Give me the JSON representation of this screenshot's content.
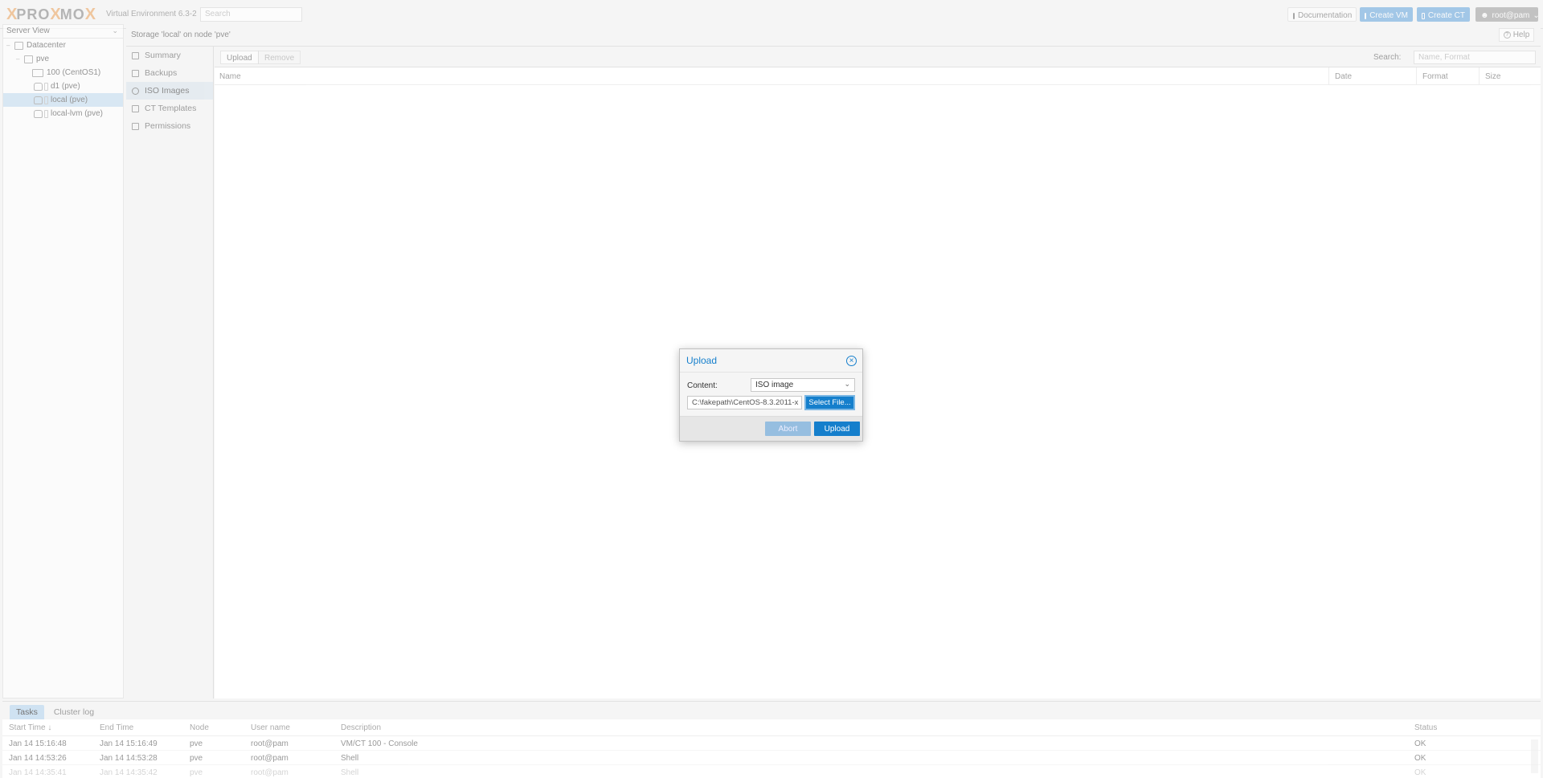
{
  "topbar": {
    "logo_text": "PRO",
    "logo_text2": "MO",
    "version": "Virtual Environment 6.3-2",
    "search_placeholder": "Search",
    "documentation_label": "Documentation",
    "create_vm_label": "Create VM",
    "create_ct_label": "Create CT",
    "user_label": "root@pam"
  },
  "left": {
    "view_selector": "Server View",
    "tree": [
      {
        "label": "Datacenter"
      },
      {
        "label": "pve"
      },
      {
        "label": "100 (CentOS1)"
      },
      {
        "label": "d1 (pve)"
      },
      {
        "label": "local (pve)"
      },
      {
        "label": "local-lvm (pve)"
      }
    ]
  },
  "content": {
    "title": "Storage 'local' on node 'pve'",
    "help_label": "Help"
  },
  "storage_nav": {
    "items": [
      {
        "label": "Summary"
      },
      {
        "label": "Backups"
      },
      {
        "label": "ISO Images"
      },
      {
        "label": "CT Templates"
      },
      {
        "label": "Permissions"
      }
    ]
  },
  "grid": {
    "upload_label": "Upload",
    "remove_label": "Remove",
    "search_label": "Search:",
    "search_placeholder": "Name, Format",
    "columns": {
      "name": "Name",
      "date": "Date",
      "format": "Format",
      "size": "Size"
    }
  },
  "bottom": {
    "tabs": [
      {
        "label": "Tasks"
      },
      {
        "label": "Cluster log"
      }
    ],
    "columns": {
      "start": "Start Time",
      "end": "End Time",
      "node": "Node",
      "user": "User name",
      "desc": "Description",
      "status": "Status"
    },
    "rows": [
      {
        "start": "Jan 14 15:16:48",
        "end": "Jan 14 15:16:49",
        "node": "pve",
        "user": "root@pam",
        "desc": "VM/CT 100 - Console",
        "status": "OK"
      },
      {
        "start": "Jan 14 14:53:26",
        "end": "Jan 14 14:53:28",
        "node": "pve",
        "user": "root@pam",
        "desc": "Shell",
        "status": "OK"
      },
      {
        "start": "Jan 14 14:35:41",
        "end": "Jan 14 14:35:42",
        "node": "pve",
        "user": "root@pam",
        "desc": "Shell",
        "status": "OK"
      }
    ]
  },
  "dialog": {
    "title": "Upload",
    "content_label": "Content:",
    "content_value": "ISO image",
    "file_value": "C:\\fakepath\\CentOS-8.3.2011-x",
    "select_file_label": "Select File...",
    "abort_label": "Abort",
    "upload_label": "Upload"
  },
  "colors": {
    "accent": "#157fcc",
    "selection": "#c6def2",
    "logo_orange": "#e57000"
  },
  "icons": {
    "close": "close-circle-icon",
    "help": "question-circle-icon",
    "user": "user-icon",
    "vm": "monitor-icon",
    "ct": "cube-icon",
    "doc": "book-icon"
  }
}
